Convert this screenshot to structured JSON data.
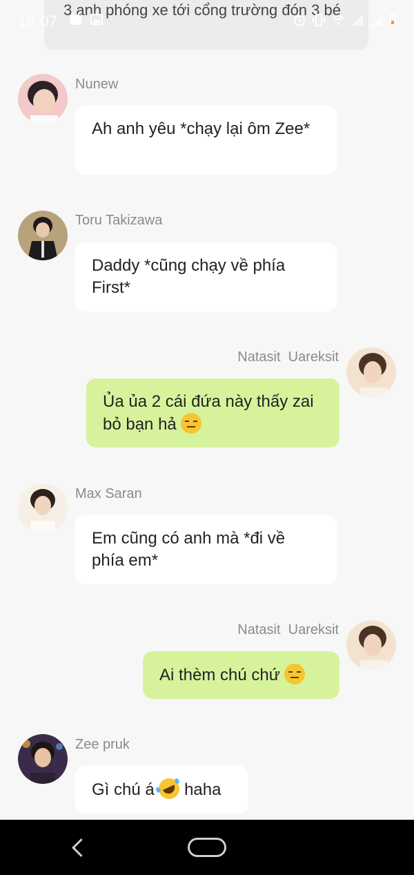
{
  "status_bar": {
    "time": "19:07",
    "left_icons": [
      "calendar-icon",
      "image-icon"
    ],
    "right_icons": [
      "alarm-icon",
      "vibrate-icon",
      "wifi-icon",
      "signal-icon",
      "signal-icon",
      "battery-icon"
    ],
    "battery_color": "#ff9a00"
  },
  "system_message": "3 anh phóng xe tới cổng trường đón 3 bé",
  "messages": [
    {
      "sender": "Nunew",
      "text": "Ah anh yêu *chạy lại ôm Zee*",
      "direction": "in"
    },
    {
      "sender": "Toru Takizawa",
      "text": "Daddy *cũng chạy về phía First*",
      "direction": "in"
    },
    {
      "sender": "Natasit  Uareksit",
      "text": "Ủa ủa 2 cái đứa này thấy zai bỏ bạn hả",
      "emoji": "expressionless-face",
      "direction": "out"
    },
    {
      "sender": "Max Saran",
      "text": "Em cũng có anh mà *đi về phía em*",
      "direction": "in"
    },
    {
      "sender": "Natasit  Uareksit",
      "text": "Ai thèm chú chứ",
      "emoji": "expressionless-face",
      "direction": "out"
    },
    {
      "sender": "Zee pruk",
      "text_before": "Gì chú á",
      "emoji": "rolling-on-floor-laughing",
      "text_after": "haha",
      "direction": "in"
    }
  ],
  "colors": {
    "background": "#f7f7f7",
    "incoming_bubble": "#ffffff",
    "outgoing_bubble": "#d6f39b",
    "sender_name": "#8a8a8a",
    "nav_bar": "#000000"
  },
  "nav_bar": {
    "buttons": [
      "back-icon",
      "home-icon"
    ]
  }
}
